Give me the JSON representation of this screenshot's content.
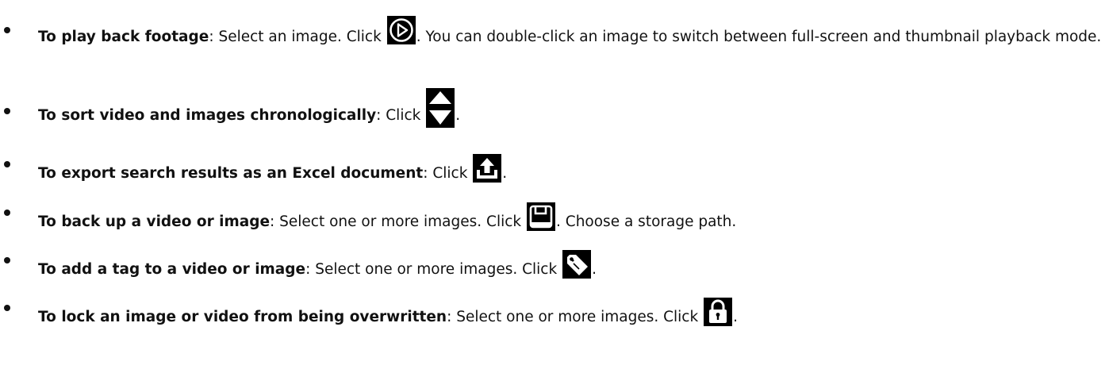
{
  "items": [
    {
      "lead": "To play back footage",
      "before_icon": ": Select an image. Click ",
      "icon": "play-circle-icon",
      "after_icon": ". You can double-click an image to switch between full-screen and thumbnail playback mode."
    },
    {
      "lead": "To sort video and images chronologically",
      "before_icon": ": Click ",
      "icon": "sort-up-down-icon",
      "after_icon": "."
    },
    {
      "lead": "To export search results as an Excel document",
      "before_icon": ": Click ",
      "icon": "export-upload-icon",
      "after_icon": "."
    },
    {
      "lead": "To back up a video or image",
      "before_icon": ": Select one or more images. Click ",
      "icon": "save-disk-icon",
      "after_icon": ". Choose a storage path."
    },
    {
      "lead": "To add a tag to a video or image",
      "before_icon": ": Select one or more images. Click ",
      "icon": "tag-icon",
      "after_icon": "."
    },
    {
      "lead": "To lock an image or video from being overwritten",
      "before_icon": ": Select one or more images. Click ",
      "icon": "lock-icon",
      "after_icon": "."
    }
  ],
  "colors": {
    "text": "#111111",
    "icon": "#000000",
    "background": "#ffffff"
  }
}
